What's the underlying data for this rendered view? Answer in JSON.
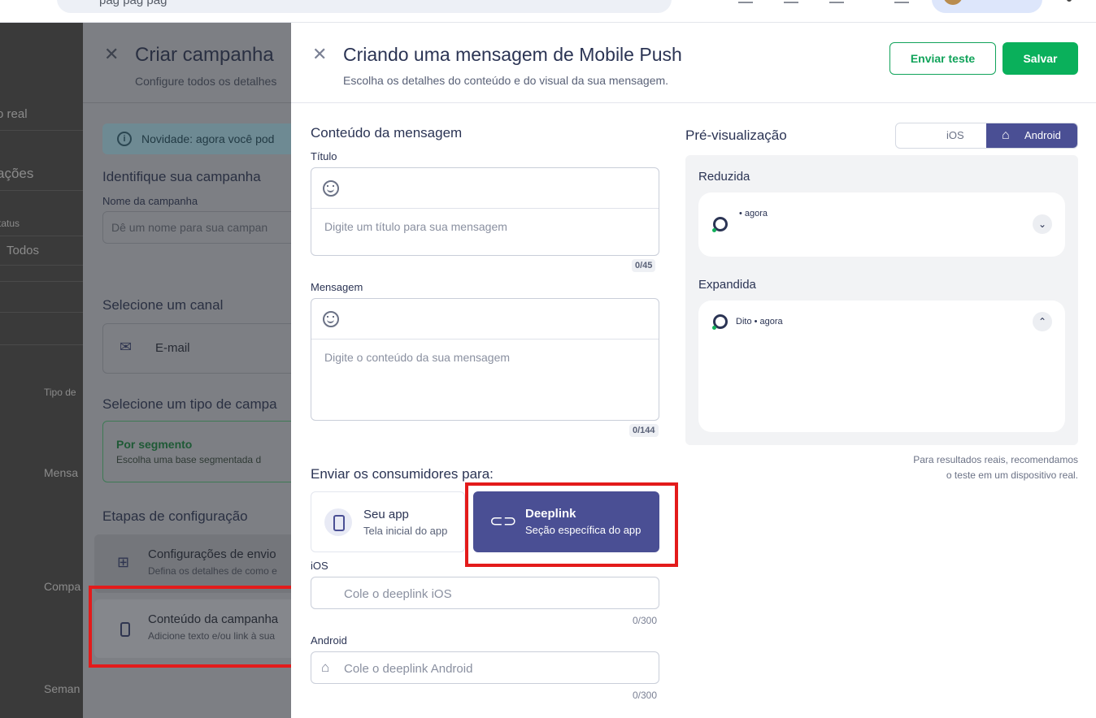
{
  "browser": {
    "url_fragment": "pag  pag  pag"
  },
  "background": {
    "left_fragments": [
      "o real",
      "ações",
      "tatus",
      "Todos",
      "Tipo de",
      "Mensa",
      "Compa",
      "Seman"
    ]
  },
  "behind_drawer": {
    "title": "Criar campanha",
    "subtitle": "Configure todos os detalhes",
    "notice": "Novidade: agora você pod",
    "identify_title": "Identifique sua campanha",
    "name_label": "Nome da campanha",
    "name_placeholder": "Dê um nome para sua campan",
    "channel_title": "Selecione um canal",
    "channel_email": "E-mail",
    "type_title": "Selecione um tipo de campa",
    "type_segment_title": "Por segmento",
    "type_segment_sub": "Escolha uma base segmentada d",
    "steps_title": "Etapas de configuração",
    "steps": [
      {
        "title": "Configurações de envio",
        "sub": "Defina os detalhes de como e"
      },
      {
        "title": "Conteúdo da campanha",
        "sub": "Adicione texto e/ou link à sua"
      }
    ]
  },
  "panel": {
    "title": "Criando uma mensagem de Mobile Push",
    "subtitle": "Escolha os detalhes do conteúdo e do visual da sua mensagem.",
    "send_test_label": "Enviar teste",
    "save_label": "Salvar",
    "content": {
      "section_title": "Conteúdo da mensagem",
      "title_label": "Título",
      "title_placeholder": "Digite um título para sua mensagem",
      "title_counter": "0/45",
      "message_label": "Mensagem",
      "message_placeholder": "Digite o conteúdo da sua mensagem",
      "message_counter": "0/144"
    },
    "destination": {
      "section_title": "Enviar os consumidores para:",
      "options": [
        {
          "title": "Seu app",
          "sub": "Tela inicial do app",
          "selected": false
        },
        {
          "title": "Deeplink",
          "sub": "Seção específica do app",
          "selected": true
        }
      ],
      "ios_label": "iOS",
      "ios_placeholder": "Cole o deeplink iOS",
      "ios_counter": "0/300",
      "android_label": "Android",
      "android_placeholder": "Cole o deeplink Android",
      "android_counter": "0/300"
    },
    "preview": {
      "title": "Pré-visualização",
      "toggle": {
        "ios": "iOS",
        "android": "Android",
        "selected": "android"
      },
      "collapsed_label": "Reduzida",
      "collapsed_meta": "• agora",
      "expanded_label": "Expandida",
      "expanded_meta": "Dito • agora",
      "note_line1": "Para resultados reais, recomendamos",
      "note_line2": "o teste em um dispositivo real."
    }
  },
  "colors": {
    "primary": "#4a4f94",
    "green": "#0ab05b",
    "highlight_red": "#e31b1b"
  }
}
